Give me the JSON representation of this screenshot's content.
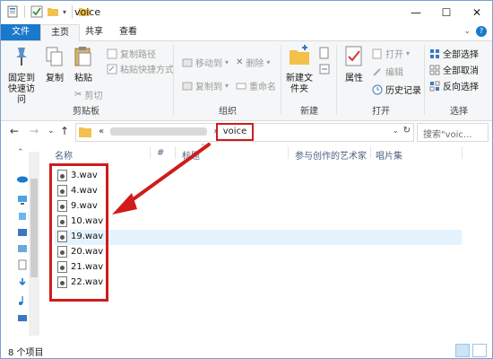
{
  "window": {
    "title": "voice"
  },
  "titlebar": {
    "minimize": "—",
    "maximize": "☐",
    "close": "✕"
  },
  "tabs": {
    "file": "文件",
    "home": "主页",
    "share": "共享",
    "view": "查看"
  },
  "ribbon": {
    "clipboard": {
      "label": "剪贴板",
      "pin": "固定到快速访问",
      "copy": "复制",
      "paste": "粘贴",
      "copy_path": "复制路径",
      "paste_shortcut": "粘贴快捷方式",
      "cut": "剪切"
    },
    "organize": {
      "label": "组织",
      "move_to": "移动到",
      "copy_to": "复制到",
      "delete": "删除",
      "rename": "重命名"
    },
    "new": {
      "label": "新建",
      "new_folder": "新建文件夹"
    },
    "open": {
      "label": "打开",
      "properties": "属性",
      "open": "打开",
      "edit": "编辑",
      "history": "历史记录"
    },
    "select": {
      "label": "选择",
      "select_all": "全部选择",
      "select_none": "全部取消",
      "invert": "反向选择"
    }
  },
  "address": {
    "prefix": "«",
    "current": "voice",
    "separator": "›",
    "search_placeholder": "搜索\"voic..."
  },
  "columns": {
    "name": "名称",
    "number": "#",
    "title": "标题",
    "artists": "参与创作的艺术家",
    "album": "唱片集"
  },
  "files": [
    "3.wav",
    "4.wav",
    "9.wav",
    "10.wav",
    "19.wav",
    "20.wav",
    "21.wav",
    "22.wav"
  ],
  "status": {
    "count": "8 个项目"
  },
  "colors": {
    "accent": "#1979ca",
    "highlight_red": "#d11b1b"
  }
}
